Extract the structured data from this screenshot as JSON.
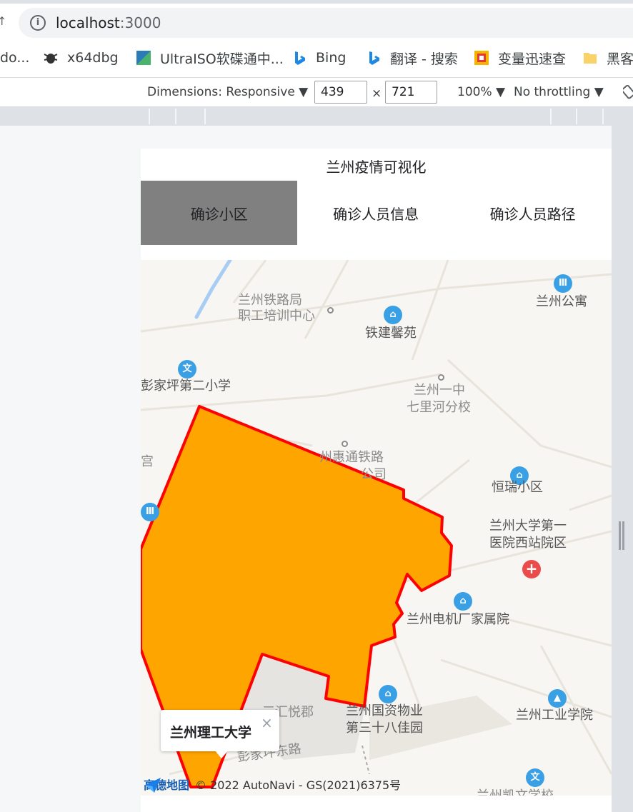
{
  "browser": {
    "url_host": "localhost",
    "url_port": ":3000",
    "bookmarks": [
      "do...",
      "x64dbg",
      "UltraISO软碟通中...",
      "Bing",
      "翻译 - 搜索",
      "变量迅速查",
      "黑客"
    ]
  },
  "devtools": {
    "dimensions_label": "Dimensions: Responsive ▼",
    "width": "439",
    "times": "×",
    "height": "721",
    "zoom": "100% ▼",
    "throttle": "No throttling ▼"
  },
  "app": {
    "title": "兰州疫情可视化",
    "tabs": [
      {
        "label": "确诊小区",
        "active": true
      },
      {
        "label": "确诊人员信息",
        "active": false
      },
      {
        "label": "确诊人员路径",
        "active": false
      }
    ]
  },
  "map": {
    "pois": [
      "兰州铁路局",
      "职工培训中心",
      "铁建馨苑",
      "兰州公寓",
      "彭家坪第二小学",
      "兰州一中",
      "七里河分校",
      "州惠通铁路",
      "公司",
      "恒瑞小区",
      "兰州大学第一",
      "医院西站院区",
      "兰州电机厂家属院",
      "兰州国资物业",
      "第三十八佳园",
      "兰州工业学院",
      "三汇悦郡",
      "彭家坪东路",
      "兰州凯文学校",
      "宫"
    ],
    "polygon_fill": "#ffa500",
    "polygon_stroke": "#ff0000",
    "popup_title": "兰州理工大学",
    "popup_close": "×",
    "logo": "高德地图",
    "copyright": "© 2022 AutoNavi - GS(2021)6375号"
  }
}
